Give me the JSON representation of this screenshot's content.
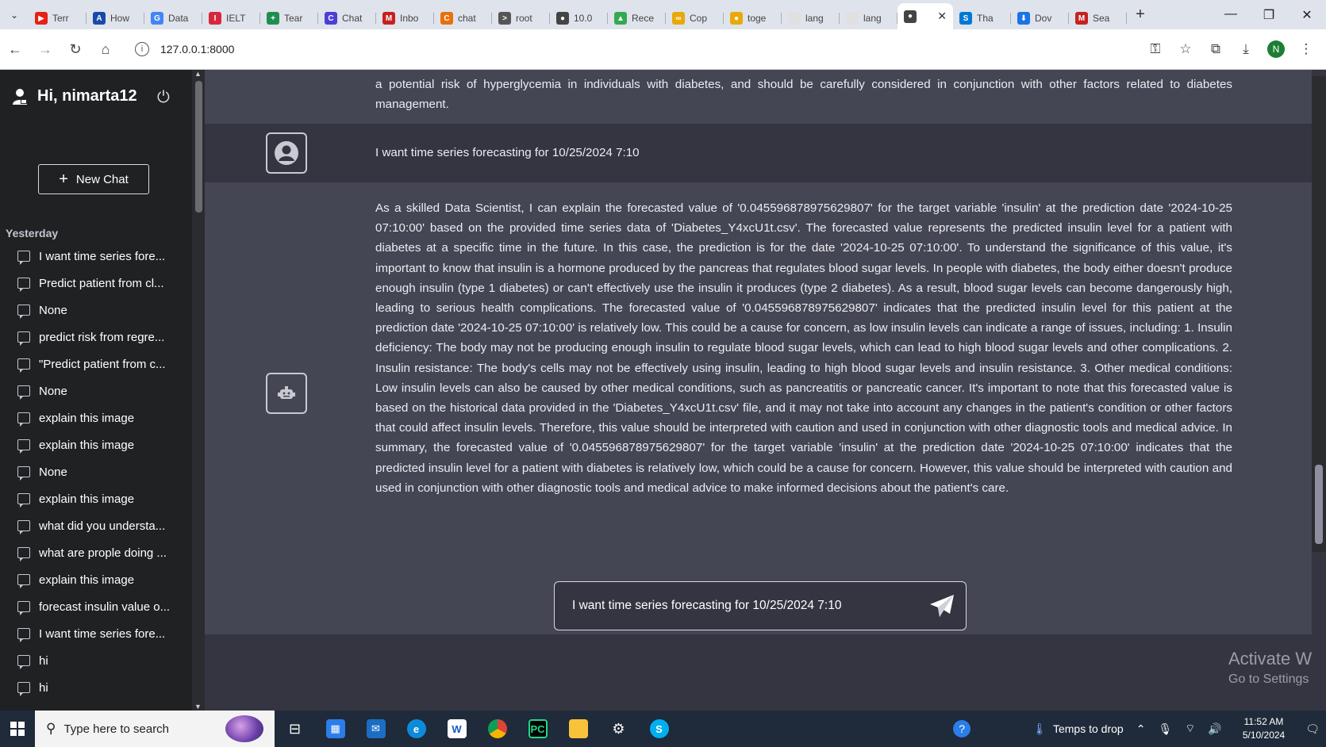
{
  "browser": {
    "tabs": [
      {
        "label": "Terr",
        "color": "#e62117",
        "glyph": "▶"
      },
      {
        "label": "How",
        "color": "#1a4aa8",
        "glyph": "A"
      },
      {
        "label": "Data",
        "color": "#4285f4",
        "glyph": "G"
      },
      {
        "label": "IELT",
        "color": "#d7263d",
        "glyph": "I"
      },
      {
        "label": "Tear",
        "color": "#1f8f4e",
        "glyph": "+"
      },
      {
        "label": "Chat",
        "color": "#4c3fd6",
        "glyph": "C"
      },
      {
        "label": "Inbo",
        "color": "#c5221f",
        "glyph": "M"
      },
      {
        "label": "chat",
        "color": "#e8710a",
        "glyph": "C"
      },
      {
        "label": "root",
        "color": "#555555",
        "glyph": ">"
      },
      {
        "label": "10.0",
        "color": "#444444",
        "glyph": "●"
      },
      {
        "label": "Rece",
        "color": "#34a853",
        "glyph": "▲"
      },
      {
        "label": "Cop",
        "color": "#e8a90a",
        "glyph": "∞"
      },
      {
        "label": "toge",
        "color": "#e8a90a",
        "glyph": "●"
      },
      {
        "label": "lang",
        "color": "#e0e0e0",
        "glyph": ""
      },
      {
        "label": "lang",
        "color": "#e0e0e0",
        "glyph": ""
      },
      {
        "label": "",
        "color": "#444444",
        "glyph": "●",
        "active": true
      },
      {
        "label": "Tha",
        "color": "#0078d4",
        "glyph": "S"
      },
      {
        "label": "Dov",
        "color": "#1a73e8",
        "glyph": "⬇"
      },
      {
        "label": "Sea",
        "color": "#c5221f",
        "glyph": "M"
      }
    ],
    "url": "127.0.0.1:8000"
  },
  "sidebar": {
    "greeting": "Hi, nimarta12",
    "new_chat": "New Chat",
    "section": "Yesterday",
    "items": [
      "I want time series fore...",
      "Predict patient from cl...",
      "None",
      "predict risk from regre...",
      "\"Predict patient from c...",
      "None",
      "explain this image",
      "explain this image",
      "None",
      "explain this image",
      "what did you understa...",
      "what are prople doing ...",
      "explain this image",
      "forecast insulin value o...",
      "I want time series fore...",
      "hi",
      "hi"
    ]
  },
  "chat": {
    "prev_tail": "a potential risk of hyperglycemia in individuals with diabetes, and should be carefully considered in conjunction with other factors related to diabetes management.",
    "user_message": "I want time series forecasting for 10/25/2024 7:10",
    "bot_message": "As a skilled Data Scientist, I can explain the forecasted value of '0.045596878975629807' for the target variable 'insulin' at the prediction date '2024-10-25 07:10:00' based on the provided time series data of 'Diabetes_Y4xcU1t.csv'. The forecasted value represents the predicted insulin level for a patient with diabetes at a specific time in the future. In this case, the prediction is for the date '2024-10-25 07:10:00'. To understand the significance of this value, it's important to know that insulin is a hormone produced by the pancreas that regulates blood sugar levels. In people with diabetes, the body either doesn't produce enough insulin (type 1 diabetes) or can't effectively use the insulin it produces (type 2 diabetes). As a result, blood sugar levels can become dangerously high, leading to serious health complications. The forecasted value of '0.045596878975629807' indicates that the predicted insulin level for this patient at the prediction date '2024-10-25 07:10:00' is relatively low. This could be a cause for concern, as low insulin levels can indicate a range of issues, including: 1. Insulin deficiency: The body may not be producing enough insulin to regulate blood sugar levels, which can lead to high blood sugar levels and other complications. 2. Insulin resistance: The body's cells may not be effectively using insulin, leading to high blood sugar levels and insulin resistance. 3. Other medical conditions: Low insulin levels can also be caused by other medical conditions, such as pancreatitis or pancreatic cancer. It's important to note that this forecasted value is based on the historical data provided in the 'Diabetes_Y4xcU1t.csv' file, and it may not take into account any changes in the patient's condition or other factors that could affect insulin levels. Therefore, this value should be interpreted with caution and used in conjunction with other diagnostic tools and medical advice. In summary, the forecasted value of '0.045596878975629807' for the target variable 'insulin' at the prediction date '2024-10-25 07:10:00' indicates that the predicted insulin level for a patient with diabetes is relatively low, which could be a cause for concern. However, this value should be interpreted with caution and used in conjunction with other diagnostic tools and medical advice to make informed decisions about the patient's care.",
    "input_value": "I want time series forecasting for 10/25/2024 7:10"
  },
  "watermark": {
    "line1": "Activate W",
    "line2": "Go to Settings"
  },
  "taskbar": {
    "search_placeholder": "Type here to search",
    "weather": "Temps to drop",
    "time": "11:52 AM",
    "date": "5/10/2024"
  },
  "profile_initial": "N"
}
